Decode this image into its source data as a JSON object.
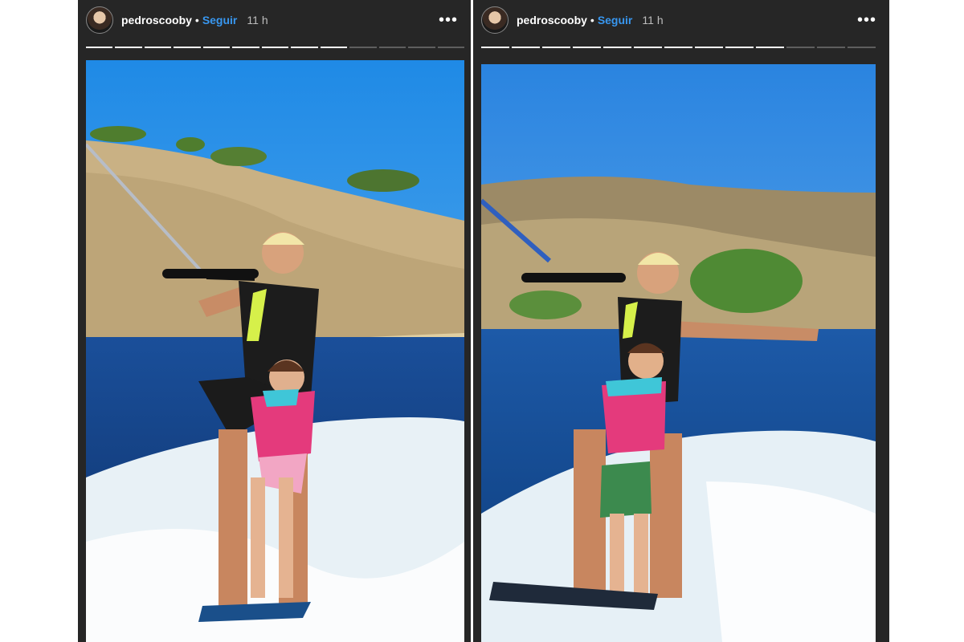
{
  "stories": [
    {
      "username": "pedroscooby",
      "separator": "•",
      "follow_label": "Seguir",
      "time": "11 h",
      "more_icon": "more-dots-icon",
      "more_glyph": "•••",
      "progress": {
        "total": 13,
        "completed": 9
      },
      "photo": "wakeboarding-man-and-child-photo"
    },
    {
      "username": "pedroscooby",
      "separator": "•",
      "follow_label": "Seguir",
      "time": "11 h",
      "more_icon": "more-dots-icon",
      "more_glyph": "•••",
      "progress": {
        "total": 13,
        "completed": 10
      },
      "photo": "wakeboarding-man-and-child-photo"
    }
  ],
  "colors": {
    "background": "#262626",
    "follow": "#3897f0",
    "progress_done": "#ffffff",
    "progress_todo": "#5e5e5e"
  }
}
